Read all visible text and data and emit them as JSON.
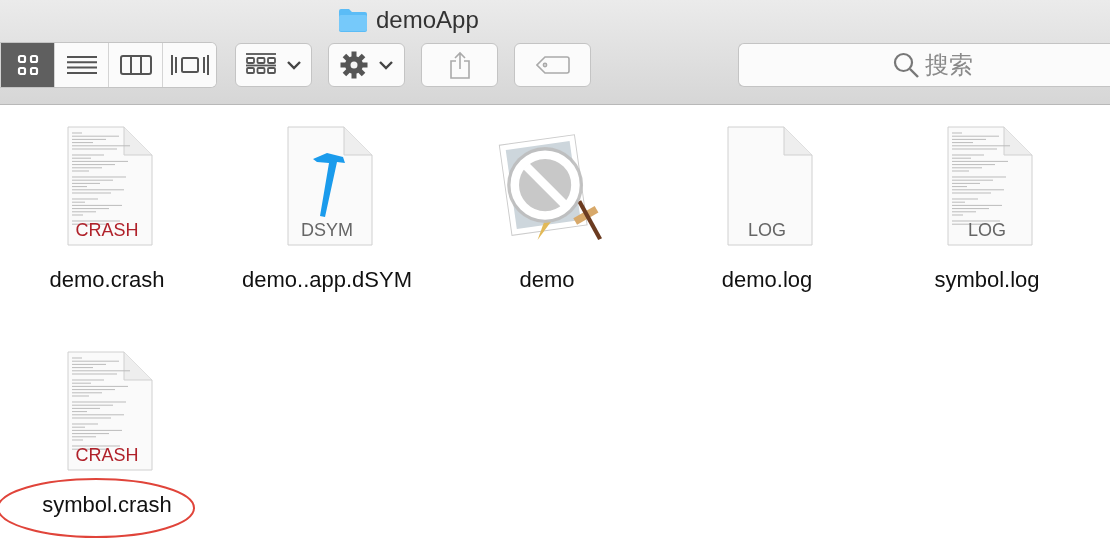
{
  "window": {
    "title": "demoApp"
  },
  "view_modes": [
    {
      "kind": "icons",
      "selected": true
    },
    {
      "kind": "list",
      "selected": false
    },
    {
      "kind": "columns",
      "selected": false
    },
    {
      "kind": "gallery",
      "selected": false
    }
  ],
  "toolbar_buttons": [
    {
      "kind": "group",
      "menu": true
    },
    {
      "kind": "action",
      "menu": true
    },
    {
      "kind": "share",
      "menu": false
    },
    {
      "kind": "tag",
      "menu": false
    }
  ],
  "search": {
    "placeholder": "搜索"
  },
  "files": [
    {
      "name": "demo.crash",
      "kind": "crash",
      "badge": "CRASH",
      "text_preview": true,
      "circled": false
    },
    {
      "name": "demo..app.dSYM",
      "kind": "dsym",
      "badge": "DSYM",
      "text_preview": false,
      "circled": false
    },
    {
      "name": "demo",
      "kind": "app",
      "circled": false
    },
    {
      "name": "demo.log",
      "kind": "log",
      "badge": "LOG",
      "text_preview": false,
      "circled": false
    },
    {
      "name": "symbol.log",
      "kind": "log",
      "badge": "LOG",
      "text_preview": true,
      "circled": false
    },
    {
      "name": "symbol.crash",
      "kind": "crash",
      "badge": "CRASH",
      "text_preview": true,
      "circled": true
    }
  ]
}
